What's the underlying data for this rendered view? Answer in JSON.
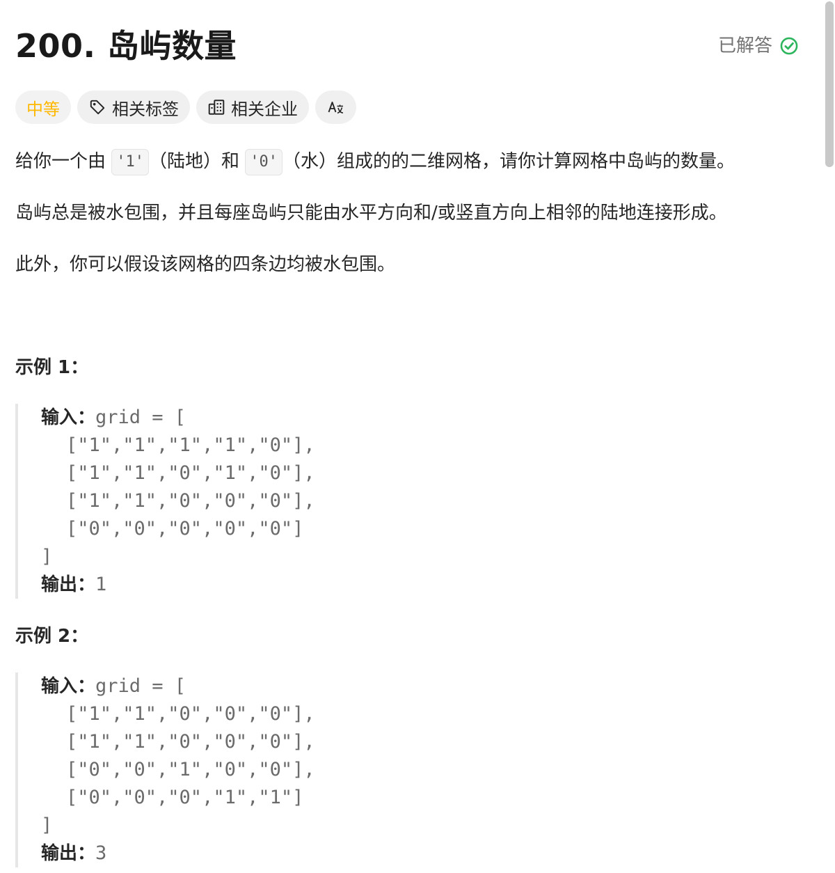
{
  "problem": {
    "title": "200. 岛屿数量",
    "status": "已解答"
  },
  "tags": {
    "difficulty": "中等",
    "related_tags": "相关标签",
    "related_companies": "相关企业",
    "translate_icon_text": "Aあ"
  },
  "description": {
    "p1_before": "给你一个由 ",
    "p1_code1": "'1'",
    "p1_mid": "（陆地）和 ",
    "p1_code2": "'0'",
    "p1_after": "（水）组成的的二维网格，请你计算网格中岛屿的数量。",
    "p2": "岛屿总是被水包围，并且每座岛屿只能由水平方向和/或竖直方向上相邻的陆地连接形成。",
    "p3": "此外，你可以假设该网格的四条边均被水包围。"
  },
  "examples": [
    {
      "title": "示例 1：",
      "input_label": "输入：",
      "input_head": "grid = [",
      "rows": [
        "[\"1\",\"1\",\"1\",\"1\",\"0\"],",
        "[\"1\",\"1\",\"0\",\"1\",\"0\"],",
        "[\"1\",\"1\",\"0\",\"0\",\"0\"],",
        "[\"0\",\"0\",\"0\",\"0\",\"0\"]"
      ],
      "close": "]",
      "output_label": "输出：",
      "output_value": "1"
    },
    {
      "title": "示例 2：",
      "input_label": "输入：",
      "input_head": "grid = [",
      "rows": [
        "[\"1\",\"1\",\"0\",\"0\",\"0\"],",
        "[\"1\",\"1\",\"0\",\"0\",\"0\"],",
        "[\"0\",\"0\",\"1\",\"0\",\"0\"],",
        "[\"0\",\"0\",\"0\",\"1\",\"1\"]"
      ],
      "close": "]",
      "output_label": "输出：",
      "output_value": "3"
    }
  ],
  "colors": {
    "accent_solved": "#2db55d",
    "difficulty_medium": "#ffb800",
    "chip_bg": "#f0f0f0"
  },
  "icons": {
    "solved": "check-circle-icon",
    "tags": "tag-icon",
    "companies": "building-icon",
    "translate": "translate-icon"
  }
}
